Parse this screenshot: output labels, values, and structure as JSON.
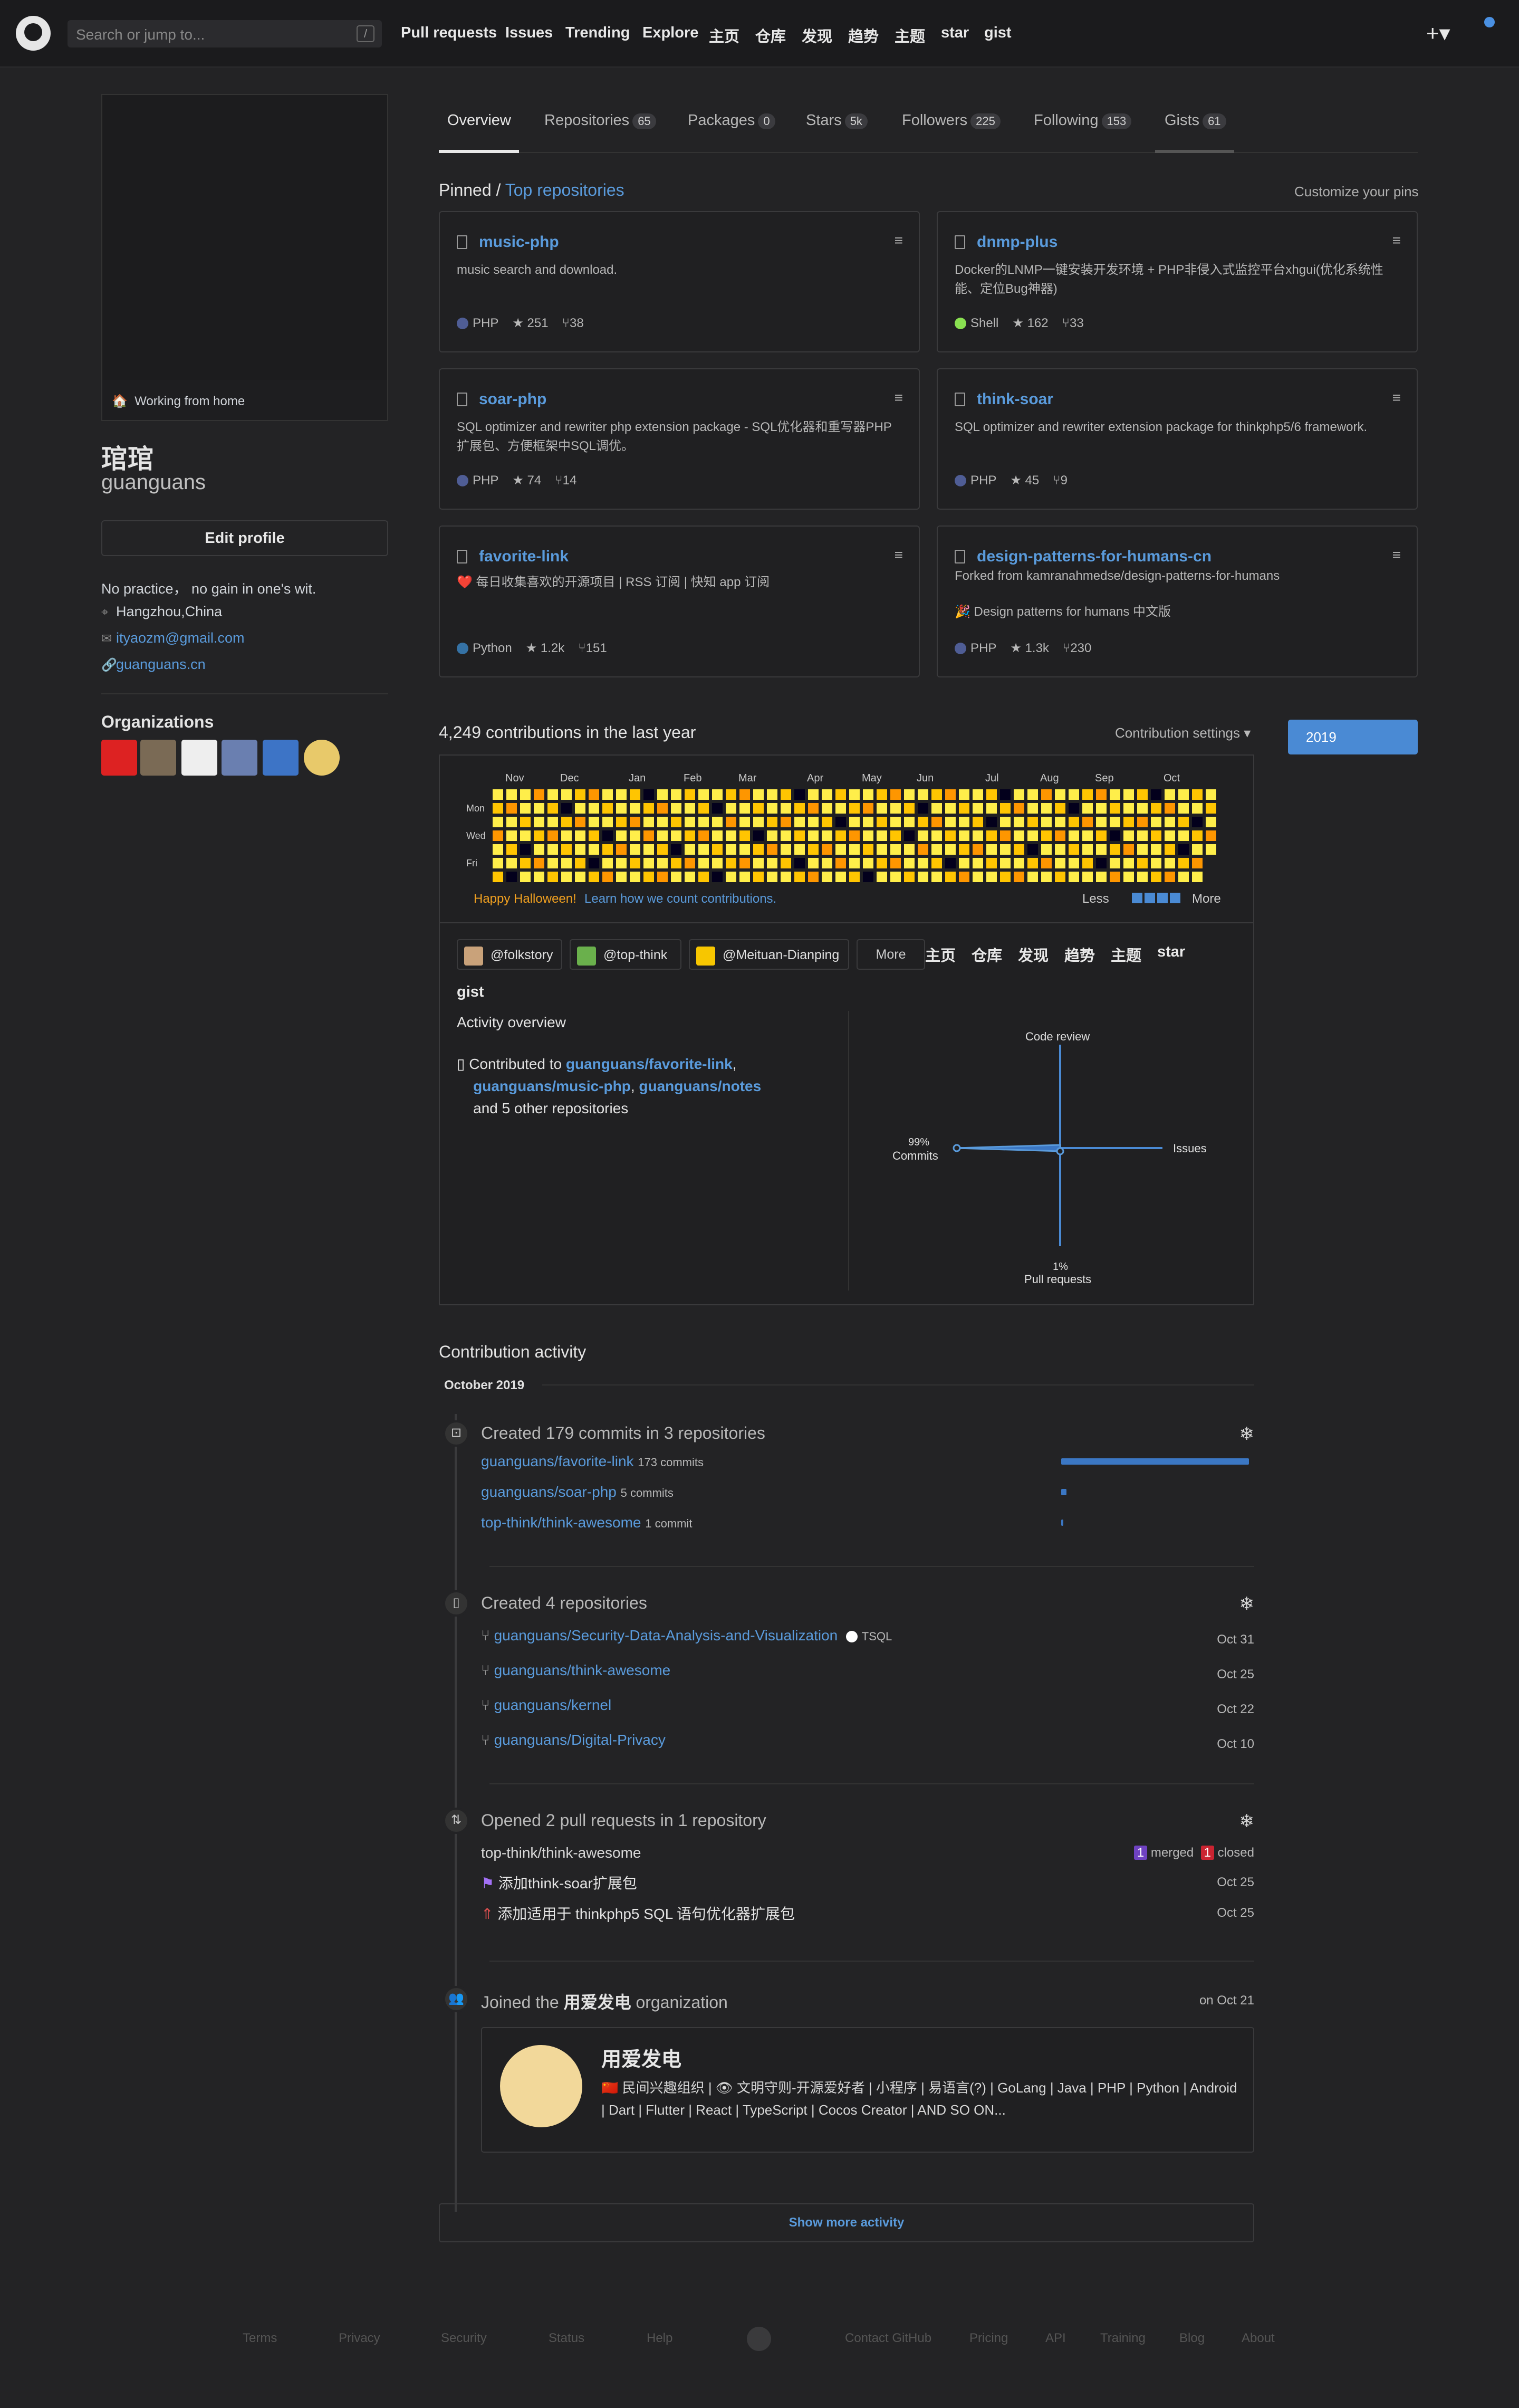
{
  "header": {
    "search_placeholder": "Search or jump to...",
    "slash": "/",
    "nav": [
      "Pull requests",
      "Issues",
      "Trending",
      "Explore",
      "主页",
      "仓库",
      "发现",
      "趋势",
      "主题",
      "star",
      "gist"
    ],
    "plus": "+▾"
  },
  "profile": {
    "status": "Working from home",
    "name": "琯琯",
    "login": "guanguans",
    "edit_label": "Edit profile",
    "bio": "No practice， no gain in one's wit.",
    "location": "Hangzhou,China",
    "email": "ityaozm@gmail.com",
    "website": "guanguans.cn",
    "orgs_title": "Organizations"
  },
  "tabs": [
    {
      "label": "Overview",
      "count": ""
    },
    {
      "label": "Repositories",
      "count": "65"
    },
    {
      "label": "Packages",
      "count": "0"
    },
    {
      "label": "Stars",
      "count": "5k"
    },
    {
      "label": "Followers",
      "count": "225"
    },
    {
      "label": "Following",
      "count": "153"
    },
    {
      "label": "Gists",
      "count": "61"
    }
  ],
  "pinned": {
    "title": "Pinned /",
    "link": "Top repositories",
    "customize": "Customize your pins",
    "repos": [
      {
        "name": "music-php",
        "desc": "music search and download.",
        "lang": "PHP",
        "lang_color": "#4f5d95",
        "stars": "251",
        "forks": "38"
      },
      {
        "name": "dnmp-plus",
        "desc": "Docker的LNMP一键安装开发环境 + PHP非侵入式监控平台xhgui(优化系统性能、定位Bug神器)",
        "lang": "Shell",
        "lang_color": "#89e051",
        "stars": "162",
        "forks": "33"
      },
      {
        "name": "soar-php",
        "desc": "SQL optimizer and rewriter php extension package - SQL优化器和重写器PHP扩展包、方便框架中SQL调优。",
        "lang": "PHP",
        "lang_color": "#4f5d95",
        "stars": "74",
        "forks": "14"
      },
      {
        "name": "think-soar",
        "desc": "SQL optimizer and rewriter extension package for thinkphp5/6 framework.",
        "lang": "PHP",
        "lang_color": "#4f5d95",
        "stars": "45",
        "forks": "9"
      },
      {
        "name": "favorite-link",
        "desc": "❤️ 每日收集喜欢的开源项目 | RSS 订阅 | 快知 app 订阅",
        "lang": "Python",
        "lang_color": "#3572a5",
        "stars": "1.2k",
        "forks": "151"
      },
      {
        "name": "design-patterns-for-humans-cn",
        "forked": "Forked from kamranahmedse/design-patterns-for-humans",
        "desc": "🎉 Design patterns for humans 中文版",
        "lang": "PHP",
        "lang_color": "#4f5d95",
        "stars": "1.3k",
        "forks": "230"
      }
    ]
  },
  "contributions": {
    "title": "4,249 contributions in the last year",
    "settings": "Contribution settings ▾",
    "year": "2019",
    "months": [
      "Nov",
      "Dec",
      "Jan",
      "Feb",
      "Mar",
      "Apr",
      "May",
      "Jun",
      "Jul",
      "Aug",
      "Sep",
      "Oct"
    ],
    "days": [
      "Mon",
      "Wed",
      "Fri"
    ],
    "halloween": "Happy Halloween!",
    "learn": "Learn how we count contributions.",
    "less": "Less",
    "more": "More"
  },
  "activity_overview": {
    "orgs": [
      "@folkstory",
      "@top-think",
      "@Meituan-Dianping"
    ],
    "more": "More",
    "inline_nav": [
      "主页",
      "仓库",
      "发现",
      "趋势",
      "主题",
      "star"
    ],
    "gist": "gist",
    "title": "Activity overview",
    "contributed_prefix": "Contributed to",
    "repo1": "guanguans/favorite-link",
    "repo2": "guanguans/music-php",
    "repo3": "guanguans/notes",
    "other": "and 5 other repositories",
    "code_review": "Code review",
    "issues": "Issues",
    "commits_pct": "99%",
    "commits": "Commits",
    "pr_pct": "1%",
    "pull_requests": "Pull requests"
  },
  "activity": {
    "title": "Contribution activity",
    "month": "October 2019",
    "commits_head": "Created 179 commits in 3 repositories",
    "commit_repos": [
      {
        "name": "guanguans/favorite-link",
        "count": "173 commits",
        "value": 173
      },
      {
        "name": "guanguans/soar-php",
        "count": "5 commits",
        "value": 5
      },
      {
        "name": "top-think/think-awesome",
        "count": "1 commit",
        "value": 1
      }
    ],
    "repos_head": "Created 4 repositories",
    "new_repos": [
      {
        "name": "guanguans/Security-Data-Analysis-and-Visualization",
        "lang": "TSQL",
        "date": "Oct 31"
      },
      {
        "name": "guanguans/think-awesome",
        "lang": "",
        "date": "Oct 25"
      },
      {
        "name": "guanguans/kernel",
        "lang": "",
        "date": "Oct 22"
      },
      {
        "name": "guanguans/Digital-Privacy",
        "lang": "",
        "date": "Oct 10"
      }
    ],
    "pr_head": "Opened 2 pull requests in 1 repository",
    "pr_repo": "top-think/think-awesome",
    "merged_n": "1",
    "merged": "merged",
    "closed_n": "1",
    "closed": "closed",
    "prs": [
      {
        "title": "添加think-soar扩展包",
        "date": "Oct 25"
      },
      {
        "title": "添加适用于 thinkphp5 SQL 语句优化器扩展包",
        "date": "Oct 25"
      }
    ],
    "joined_prefix": "Joined the",
    "joined_org": "用爱发电",
    "joined_suffix": "organization",
    "joined_date": "on Oct 21",
    "org_name": "用爱发电",
    "org_desc": "🇨🇳 民间兴趣组织 | 👁 文明守则-开源爱好者 | 小程序 | 易语言(?) | GoLang | Java | PHP | Python | Android | Dart | Flutter | React | TypeScript | Cocos Creator | AND SO ON...",
    "show_more": "Show more activity"
  },
  "footer": [
    "Terms",
    "Privacy",
    "Security",
    "Status",
    "Help",
    "Contact GitHub",
    "Pricing",
    "API",
    "Training",
    "Blog",
    "About"
  ]
}
